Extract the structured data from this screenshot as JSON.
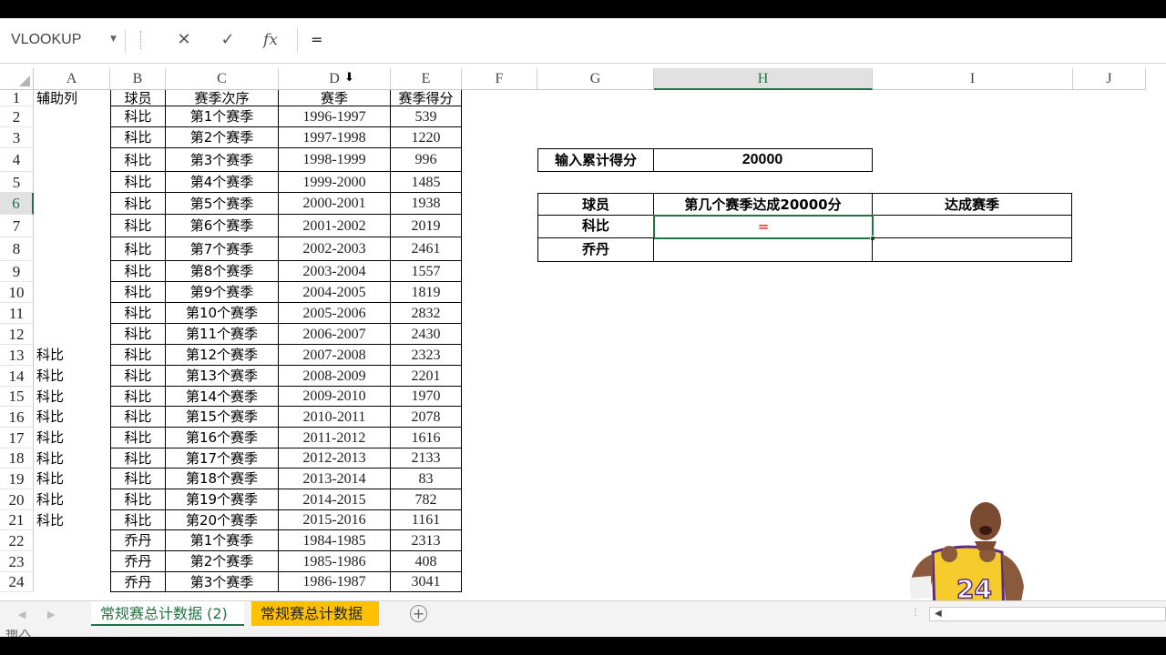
{
  "formula_bar": {
    "name_box": "VLOOKUP",
    "cancel_icon": "✕",
    "enter_icon": "✓",
    "fx_label": "fx",
    "formula": "="
  },
  "columns": [
    "A",
    "B",
    "C",
    "D",
    "E",
    "F",
    "G",
    "H",
    "I",
    "J"
  ],
  "selected_column": "H",
  "selected_row": 6,
  "table": {
    "headers": {
      "helper": "辅助列",
      "player": "球员",
      "season_no": "赛季次序",
      "season": "赛季",
      "points": "赛季得分"
    },
    "rows": [
      {
        "helper": "",
        "player": "科比",
        "season_no": "第1个赛季",
        "season": "1996-1997",
        "points": "539"
      },
      {
        "helper": "",
        "player": "科比",
        "season_no": "第2个赛季",
        "season": "1997-1998",
        "points": "1220"
      },
      {
        "helper": "",
        "player": "科比",
        "season_no": "第3个赛季",
        "season": "1998-1999",
        "points": "996"
      },
      {
        "helper": "",
        "player": "科比",
        "season_no": "第4个赛季",
        "season": "1999-2000",
        "points": "1485"
      },
      {
        "helper": "",
        "player": "科比",
        "season_no": "第5个赛季",
        "season": "2000-2001",
        "points": "1938"
      },
      {
        "helper": "",
        "player": "科比",
        "season_no": "第6个赛季",
        "season": "2001-2002",
        "points": "2019"
      },
      {
        "helper": "",
        "player": "科比",
        "season_no": "第7个赛季",
        "season": "2002-2003",
        "points": "2461"
      },
      {
        "helper": "",
        "player": "科比",
        "season_no": "第8个赛季",
        "season": "2003-2004",
        "points": "1557"
      },
      {
        "helper": "",
        "player": "科比",
        "season_no": "第9个赛季",
        "season": "2004-2005",
        "points": "1819"
      },
      {
        "helper": "",
        "player": "科比",
        "season_no": "第10个赛季",
        "season": "2005-2006",
        "points": "2832"
      },
      {
        "helper": "",
        "player": "科比",
        "season_no": "第11个赛季",
        "season": "2006-2007",
        "points": "2430"
      },
      {
        "helper": "科比",
        "player": "科比",
        "season_no": "第12个赛季",
        "season": "2007-2008",
        "points": "2323"
      },
      {
        "helper": "科比",
        "player": "科比",
        "season_no": "第13个赛季",
        "season": "2008-2009",
        "points": "2201"
      },
      {
        "helper": "科比",
        "player": "科比",
        "season_no": "第14个赛季",
        "season": "2009-2010",
        "points": "1970"
      },
      {
        "helper": "科比",
        "player": "科比",
        "season_no": "第15个赛季",
        "season": "2010-2011",
        "points": "2078"
      },
      {
        "helper": "科比",
        "player": "科比",
        "season_no": "第16个赛季",
        "season": "2011-2012",
        "points": "1616"
      },
      {
        "helper": "科比",
        "player": "科比",
        "season_no": "第17个赛季",
        "season": "2012-2013",
        "points": "2133"
      },
      {
        "helper": "科比",
        "player": "科比",
        "season_no": "第18个赛季",
        "season": "2013-2014",
        "points": "83"
      },
      {
        "helper": "科比",
        "player": "科比",
        "season_no": "第19个赛季",
        "season": "2014-2015",
        "points": "782"
      },
      {
        "helper": "科比",
        "player": "科比",
        "season_no": "第20个赛季",
        "season": "2015-2016",
        "points": "1161"
      },
      {
        "helper": "",
        "player": "乔丹",
        "season_no": "第1个赛季",
        "season": "1984-1985",
        "points": "2313"
      },
      {
        "helper": "",
        "player": "乔丹",
        "season_no": "第2个赛季",
        "season": "1985-1986",
        "points": "408"
      },
      {
        "helper": "",
        "player": "乔丹",
        "season_no": "第3个赛季",
        "season": "1986-1987",
        "points": "3041"
      }
    ]
  },
  "lookup": {
    "input_label": "输入累计得分",
    "input_value": "20000",
    "col_player": "球员",
    "col_nth_season": "第几个赛季达成20000分",
    "col_season": "达成赛季",
    "players": [
      "科比",
      "乔丹"
    ],
    "active_cell_value": "="
  },
  "jersey_number": "24",
  "sheets": [
    {
      "label": "常规赛总计数据 (2)",
      "active": true
    },
    {
      "label": "常规赛总计数据",
      "active": false,
      "color": "#ffc000"
    }
  ],
  "status_text": "输入",
  "colors": {
    "accent": "#217346",
    "tab_highlight": "#ffc000",
    "formula_red": "#e00000"
  }
}
